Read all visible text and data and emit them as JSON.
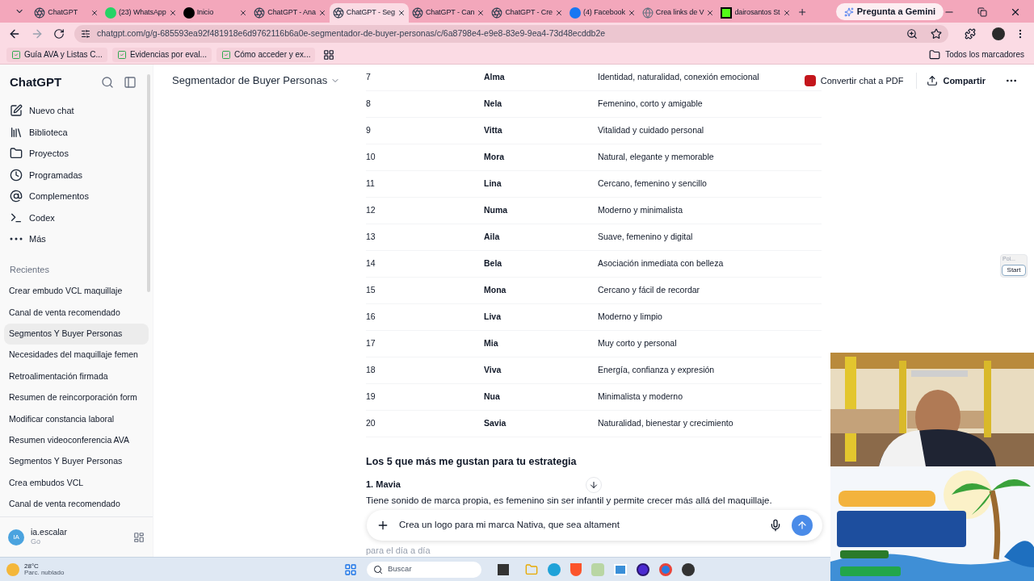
{
  "browser": {
    "tabs": [
      {
        "title": "ChatGPT",
        "selected": false
      },
      {
        "title": "(23) WhatsApp",
        "selected": false
      },
      {
        "title": "Inicio",
        "selected": false
      },
      {
        "title": "ChatGPT - Ana",
        "selected": false
      },
      {
        "title": "ChatGPT - Seg",
        "selected": true
      },
      {
        "title": "ChatGPT - Can",
        "selected": false
      },
      {
        "title": "ChatGPT - Cre",
        "selected": false
      },
      {
        "title": "(4) Facebook",
        "selected": false
      },
      {
        "title": "Crea links de V",
        "selected": false
      },
      {
        "title": "dairosantos St",
        "selected": false
      }
    ],
    "gemini_button": "Pregunta a Gemini",
    "url": "chatgpt.com/g/g-685593ea92f481918e6d9762116b6a0e-segmentador-de-buyer-personas/c/6a8798e4-e9e8-83e9-9ea4-73d48ecddb2e",
    "bookmarks": [
      "Guía AVA y Listas C...",
      "Evidencias por eval...",
      "Cómo acceder y ex..."
    ],
    "all_bookmarks": "Todos los marcadores"
  },
  "sidebar": {
    "brand": "ChatGPT",
    "nav": [
      {
        "label": "Nuevo chat",
        "kind": "new"
      },
      {
        "label": "Biblioteca",
        "kind": "library"
      },
      {
        "label": "Proyectos",
        "kind": "projects"
      },
      {
        "label": "Programadas",
        "kind": "scheduled"
      },
      {
        "label": "Complementos",
        "kind": "apps"
      },
      {
        "label": "Codex",
        "kind": "codex"
      },
      {
        "label": "Más",
        "kind": "more"
      }
    ],
    "recents_heading": "Recientes",
    "recents": [
      {
        "title": "Crear embudo VCL maquillaje",
        "selected": false
      },
      {
        "title": "Canal de venta recomendado",
        "selected": false
      },
      {
        "title": "Segmentos Y Buyer Personas",
        "selected": true
      },
      {
        "title": "Necesidades del maquillaje femen",
        "selected": false
      },
      {
        "title": "Retroalimentación firmada",
        "selected": false
      },
      {
        "title": "Resumen de reincorporación form",
        "selected": false
      },
      {
        "title": "Modificar constancia laboral",
        "selected": false
      },
      {
        "title": "Resumen videoconferencia AVA",
        "selected": false
      },
      {
        "title": "Segmentos Y Buyer Personas",
        "selected": false
      },
      {
        "title": "Crea embudos VCL",
        "selected": false
      },
      {
        "title": "Canal de venta recomendado",
        "selected": false
      }
    ],
    "user": {
      "initials": "IA",
      "name": "ia.escalar",
      "plan": "Go"
    }
  },
  "header": {
    "title": "Segmentador de Buyer Personas",
    "pdf_button": "Convertir chat a PDF",
    "share_button": "Compartir"
  },
  "table": {
    "rows": [
      {
        "number": "7",
        "name": "Alma",
        "description": "Identidad, naturalidad, conexión emocional"
      },
      {
        "number": "8",
        "name": "Nela",
        "description": "Femenino, corto y amigable"
      },
      {
        "number": "9",
        "name": "Vitta",
        "description": "Vitalidad y cuidado personal"
      },
      {
        "number": "10",
        "name": "Mora",
        "description": "Natural, elegante y memorable"
      },
      {
        "number": "11",
        "name": "Lina",
        "description": "Cercano, femenino y sencillo"
      },
      {
        "number": "12",
        "name": "Numa",
        "description": "Moderno y minimalista"
      },
      {
        "number": "13",
        "name": "Aila",
        "description": "Suave, femenino y digital"
      },
      {
        "number": "14",
        "name": "Bela",
        "description": "Asociación inmediata con belleza"
      },
      {
        "number": "15",
        "name": "Mona",
        "description": "Cercano y fácil de recordar"
      },
      {
        "number": "16",
        "name": "Liva",
        "description": "Moderno y limpio"
      },
      {
        "number": "17",
        "name": "Mia",
        "description": "Muy corto y personal"
      },
      {
        "number": "18",
        "name": "Viva",
        "description": "Energía, confianza y expresión"
      },
      {
        "number": "19",
        "name": "Nua",
        "description": "Minimalista y moderno"
      },
      {
        "number": "20",
        "name": "Savia",
        "description": "Naturalidad, bienestar y crecimiento"
      }
    ]
  },
  "section": {
    "heading": "Los 5 que más me gustan para tu estrategia",
    "item_title": "1. Mavia",
    "item_text": "Tiene sonido de marca propia, es femenino sin ser infantil y permite crecer más allá del maquillaje.",
    "faded_text": "para el día a día"
  },
  "composer": {
    "value": "Crea un logo para mi marca Nativa, que sea altament"
  },
  "widget": {
    "label": "Poi...",
    "button": "Start"
  },
  "taskbar": {
    "temperature": "28°C",
    "condition": "Parc. nublado",
    "search_placeholder": "Buscar"
  }
}
